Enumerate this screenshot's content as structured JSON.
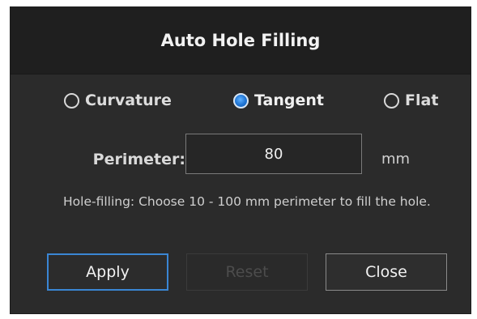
{
  "dialog": {
    "title": "Auto Hole Filling",
    "mode_options": [
      {
        "label": "Curvature",
        "checked": false
      },
      {
        "label": "Tangent",
        "checked": true
      },
      {
        "label": "Flat",
        "checked": false
      }
    ],
    "perimeter": {
      "label": "Perimeter:",
      "value": "80",
      "unit": "mm"
    },
    "hint": "Hole-filling:  Choose 10 - 100 mm perimeter to fill the hole.",
    "buttons": {
      "apply": "Apply",
      "reset": "Reset",
      "close": "Close"
    }
  },
  "colors": {
    "dialog_bg": "#2b2b2b",
    "titlebar_bg": "#1f1f1f",
    "accent": "#3a86d4",
    "radio_checked": "#1e73d2"
  },
  "icons": [
    "radio-unchecked-icon",
    "radio-checked-icon"
  ]
}
